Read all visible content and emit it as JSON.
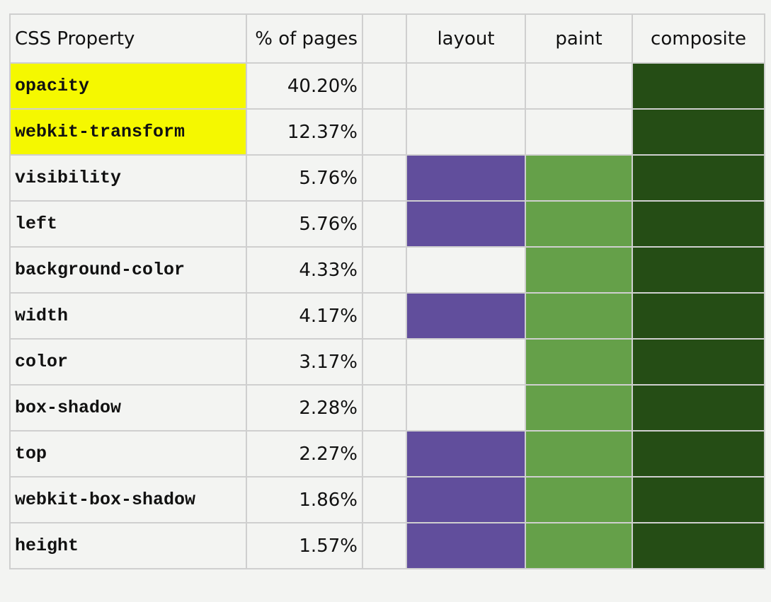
{
  "table": {
    "headers": {
      "property": "CSS Property",
      "percent": "% of pages",
      "spacer": "",
      "layout": "layout",
      "paint": "paint",
      "composite": "composite"
    },
    "colors": {
      "highlight": "#f5f800",
      "layout": "#614e9c",
      "paint": "#65a049",
      "composite": "#254d15"
    },
    "rows": [
      {
        "property": "opacity",
        "percent": "40.20%",
        "highlighted": true,
        "layout": false,
        "paint": false,
        "composite": true
      },
      {
        "property": "webkit-transform",
        "percent": "12.37%",
        "highlighted": true,
        "layout": false,
        "paint": false,
        "composite": true
      },
      {
        "property": "visibility",
        "percent": "5.76%",
        "highlighted": false,
        "layout": true,
        "paint": true,
        "composite": true
      },
      {
        "property": "left",
        "percent": "5.76%",
        "highlighted": false,
        "layout": true,
        "paint": true,
        "composite": true
      },
      {
        "property": "background-color",
        "percent": "4.33%",
        "highlighted": false,
        "layout": false,
        "paint": true,
        "composite": true
      },
      {
        "property": "width",
        "percent": "4.17%",
        "highlighted": false,
        "layout": true,
        "paint": true,
        "composite": true
      },
      {
        "property": "color",
        "percent": "3.17%",
        "highlighted": false,
        "layout": false,
        "paint": true,
        "composite": true
      },
      {
        "property": "box-shadow",
        "percent": "2.28%",
        "highlighted": false,
        "layout": false,
        "paint": true,
        "composite": true
      },
      {
        "property": "top",
        "percent": "2.27%",
        "highlighted": false,
        "layout": true,
        "paint": true,
        "composite": true
      },
      {
        "property": "webkit-box-shadow",
        "percent": "1.86%",
        "highlighted": false,
        "layout": true,
        "paint": true,
        "composite": true
      },
      {
        "property": "height",
        "percent": "1.57%",
        "highlighted": false,
        "layout": true,
        "paint": true,
        "composite": true
      }
    ]
  }
}
